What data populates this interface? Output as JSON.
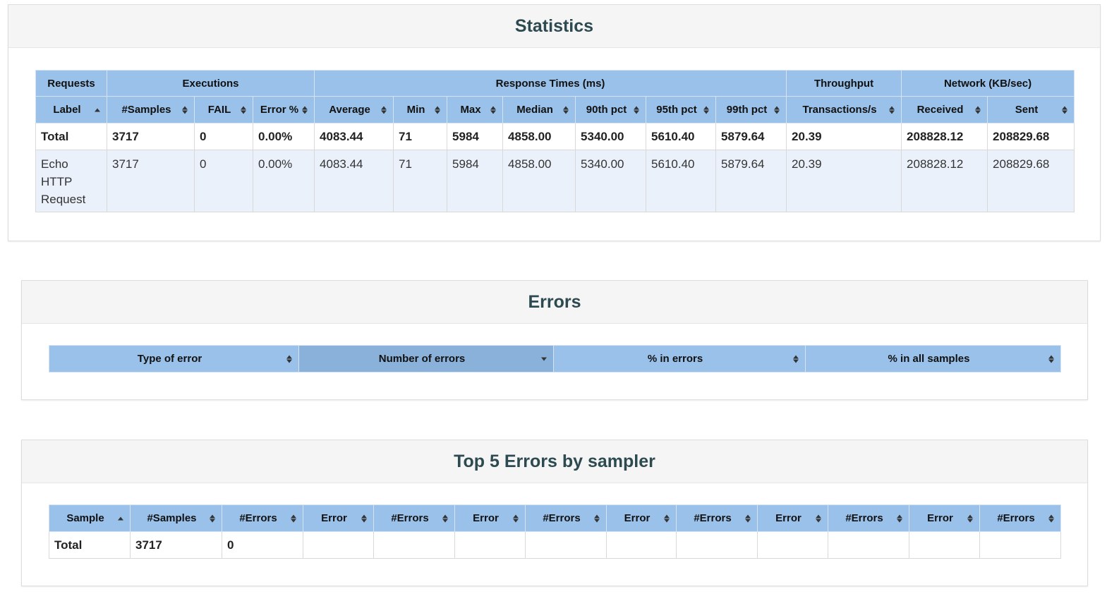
{
  "statistics": {
    "title": "Statistics",
    "group_headers": {
      "requests": "Requests",
      "executions": "Executions",
      "response_times": "Response Times (ms)",
      "throughput": "Throughput",
      "network": "Network (KB/sec)"
    },
    "columns": [
      "Label",
      "#Samples",
      "FAIL",
      "Error %",
      "Average",
      "Min",
      "Max",
      "Median",
      "90th pct",
      "95th pct",
      "99th pct",
      "Transactions/s",
      "Received",
      "Sent"
    ],
    "total_row": [
      "Total",
      "3717",
      "0",
      "0.00%",
      "4083.44",
      "71",
      "5984",
      "4858.00",
      "5340.00",
      "5610.40",
      "5879.64",
      "20.39",
      "208828.12",
      "208829.68"
    ],
    "rows": [
      [
        "Echo HTTP Request",
        "3717",
        "0",
        "0.00%",
        "4083.44",
        "71",
        "5984",
        "4858.00",
        "5340.00",
        "5610.40",
        "5879.64",
        "20.39",
        "208828.12",
        "208829.68"
      ]
    ]
  },
  "errors": {
    "title": "Errors",
    "columns": [
      "Type of error",
      "Number of errors",
      "% in errors",
      "% in all samples"
    ]
  },
  "top5": {
    "title": "Top 5 Errors by sampler",
    "columns": [
      "Sample",
      "#Samples",
      "#Errors",
      "Error",
      "#Errors",
      "Error",
      "#Errors",
      "Error",
      "#Errors",
      "Error",
      "#Errors",
      "Error",
      "#Errors"
    ],
    "total_row": [
      "Total",
      "3717",
      "0",
      "",
      "",
      "",
      "",
      "",
      "",
      "",
      "",
      "",
      ""
    ]
  },
  "colors": {
    "header_bg": "#99c1ea",
    "sorted_header_bg": "#8ab1da",
    "odd_row_bg": "#eaf1fb",
    "panel_heading_bg": "#f5f5f5",
    "title_color": "#2c4a4f"
  },
  "icons": {
    "sort_both": "sort-icon",
    "sort_asc": "sort-asc-icon",
    "sort_desc": "sort-desc-icon"
  }
}
